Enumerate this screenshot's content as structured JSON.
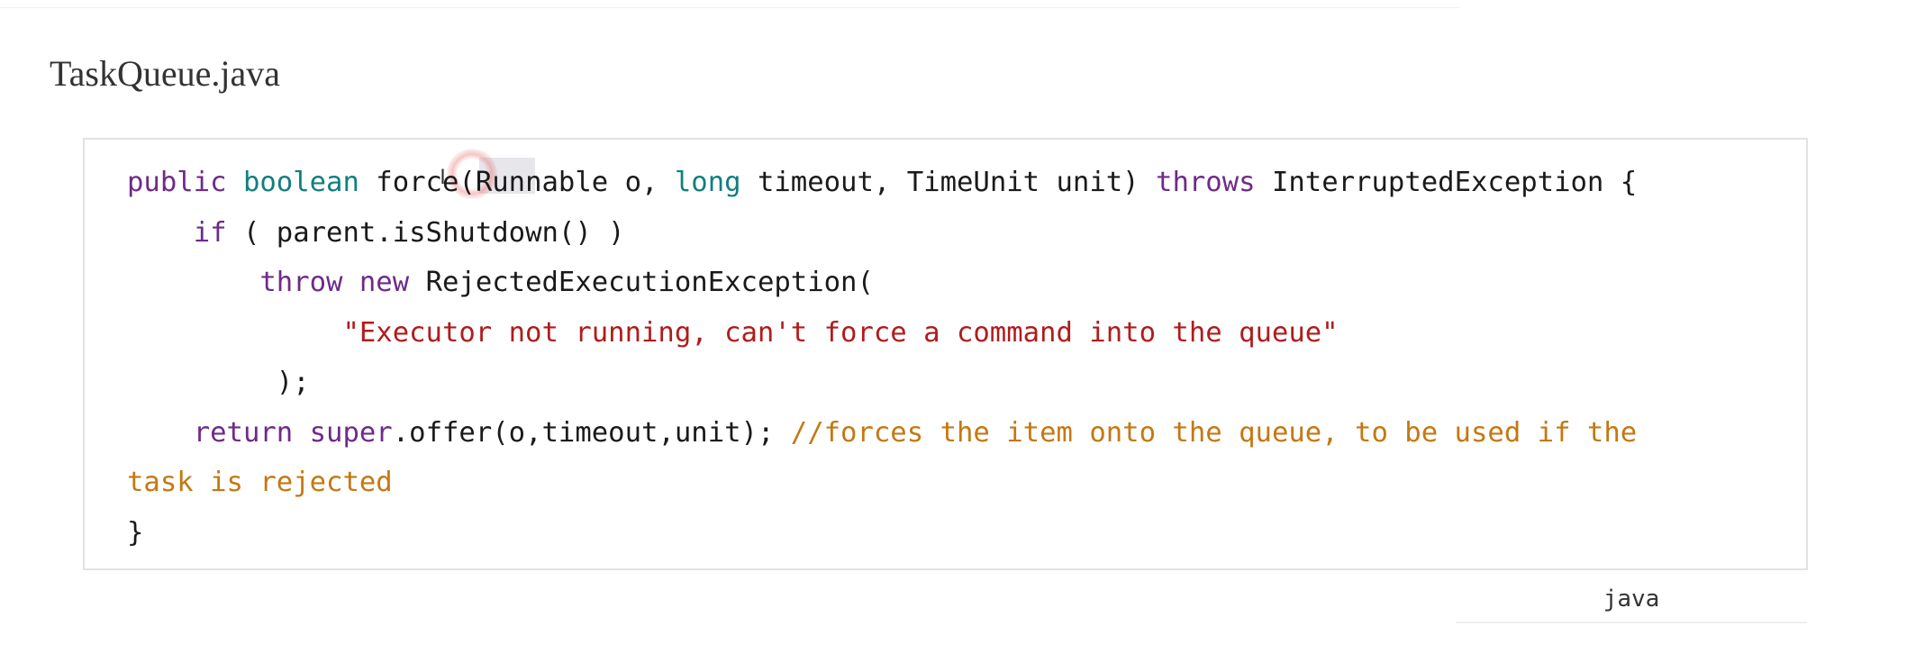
{
  "file": {
    "title": "TaskQueue.java"
  },
  "code": {
    "language_label": "java",
    "tokens": {
      "l1_public": "public",
      "l1_boolean": "boolean",
      "l1_force": "force",
      "l1_params_a": "(Runnable o, ",
      "l1_long": "long",
      "l1_params_b": " timeout, TimeUnit unit) ",
      "l1_throws": "throws",
      "l1_tail": " InterruptedException {",
      "l2_if": "if",
      "l2_rest": " ( parent.isShutdown() )",
      "l3_throw": "throw",
      "l3_new": "new",
      "l3_rest": " RejectedExecutionException(",
      "l4_string": "\"Executor not running, can't force a command into the queue\"",
      "l5_close": ");",
      "l6_return": "return",
      "l6_super": "super",
      "l6_rest": ".offer(o,timeout,unit); ",
      "l6_comment": "//forces the item onto the queue, to be used if the",
      "l7_comment": "task is rejected",
      "l8_brace": "}"
    }
  },
  "colors": {
    "keyword": "#6f2a89",
    "type": "#117f7f",
    "string": "#b01c1c",
    "comment": "#c47812"
  }
}
